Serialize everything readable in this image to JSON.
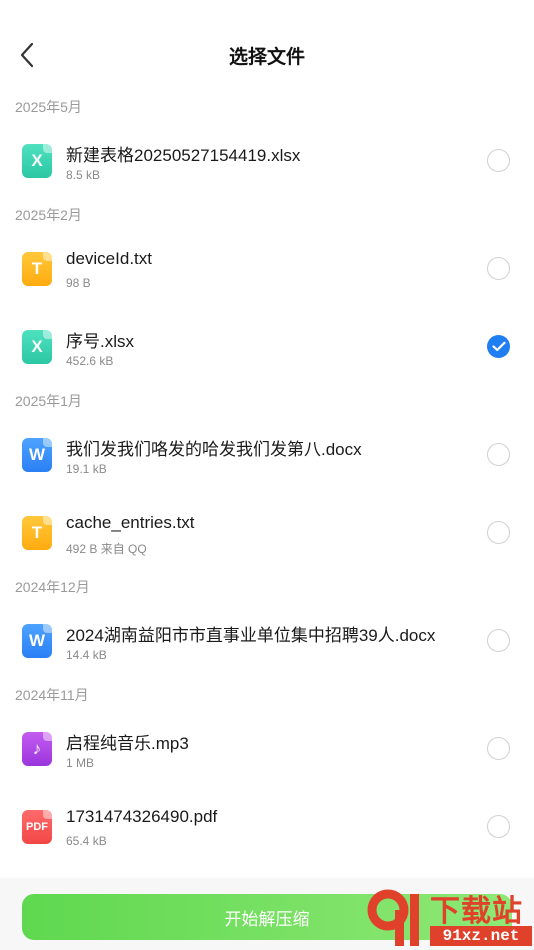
{
  "header": {
    "title": "选择文件"
  },
  "groups": [
    {
      "label": "2025年5月",
      "files": [
        {
          "name": "新建表格20250527154419.xlsx",
          "meta": "8.5 kB",
          "type": "xlsx",
          "glyph": "X",
          "selected": false
        }
      ]
    },
    {
      "label": "2025年2月",
      "files": [
        {
          "name": "deviceId.txt",
          "meta": "98 B",
          "type": "txt",
          "glyph": "T",
          "selected": false
        },
        {
          "name": "序号.xlsx",
          "meta": "452.6 kB",
          "type": "xlsx",
          "glyph": "X",
          "selected": true
        }
      ]
    },
    {
      "label": "2025年1月",
      "files": [
        {
          "name": "我们发我们咯发的哈发我们发第八.docx",
          "meta": "19.1 kB",
          "type": "docx",
          "glyph": "W",
          "selected": false
        },
        {
          "name": "cache_entries.txt",
          "meta": "492 B  来自 QQ",
          "type": "txt",
          "glyph": "T",
          "selected": false
        }
      ]
    },
    {
      "label": "2024年12月",
      "files": [
        {
          "name": "2024湖南益阳市市直事业单位集中招聘39人.docx",
          "meta": "14.4 kB",
          "type": "docx",
          "glyph": "W",
          "selected": false
        }
      ]
    },
    {
      "label": "2024年11月",
      "files": [
        {
          "name": "启程纯音乐.mp3",
          "meta": "1 MB",
          "type": "mp3",
          "glyph": "♪",
          "selected": false
        },
        {
          "name": "1731474326490.pdf",
          "meta": "65.4 kB",
          "type": "pdf",
          "glyph": "PDF",
          "selected": false
        }
      ]
    }
  ],
  "actions": {
    "start_label": "开始解压缩"
  },
  "watermark": {
    "title": "下载站",
    "url": "91xz.net"
  },
  "colors": {
    "accent": "#1f7ef2",
    "button": "#6adc55",
    "watermark": "#e0412b"
  },
  "icons": {
    "back": "chevron-left-icon",
    "check": "check-icon"
  }
}
